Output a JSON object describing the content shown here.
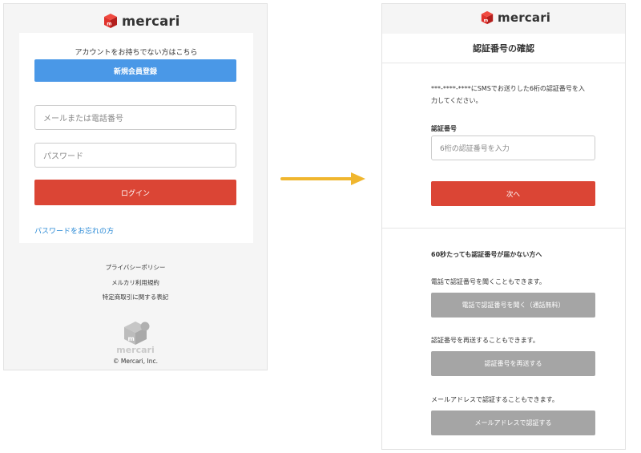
{
  "brand": {
    "name": "mercari",
    "logo_icon": "mercari-box-logo",
    "colors": {
      "red": "#e0322c",
      "red_dark": "#b31f1d",
      "blue": "#4a98e7",
      "gray_logo": "#bcbcbc"
    }
  },
  "login": {
    "signup_prompt": "アカウントをお持ちでない方はこちら",
    "signup_button": "新規会員登録",
    "id_placeholder": "メールまたは電話番号",
    "password_placeholder": "パスワード",
    "login_button": "ログイン",
    "forgot_link": "パスワードをお忘れの方",
    "footer_links": [
      "プライバシーポリシー",
      "メルカリ利用規約",
      "特定商取引に関する表記"
    ],
    "footer_brand": "mercari",
    "copyright": "© Mercari, Inc.",
    "colors": {
      "accent": "#db4535",
      "link": "#2a8ad6"
    }
  },
  "flow_arrow": {
    "icon": "right-arrow-icon",
    "color": "#f0b62e"
  },
  "verify": {
    "title": "認証番号の確認",
    "instructions_line1": "***-****-****にSMSでお送りした6桁の認証番号を入",
    "instructions_line2": "力してください。",
    "code_label": "認証番号",
    "code_placeholder": "6桁の認証番号を入力",
    "next_button": "次へ",
    "help_heading": "60秒たっても認証番号が届かない方へ",
    "call_text": "電話で認証番号を聞くこともできます。",
    "call_button": "電話で認証番号を聞く（通話無料）",
    "resend_text": "認証番号を再送することもできます。",
    "resend_button": "認証番号を再送する",
    "email_text": "メールアドレスで認証することもできます。",
    "email_button": "メールアドレスで認証する"
  }
}
